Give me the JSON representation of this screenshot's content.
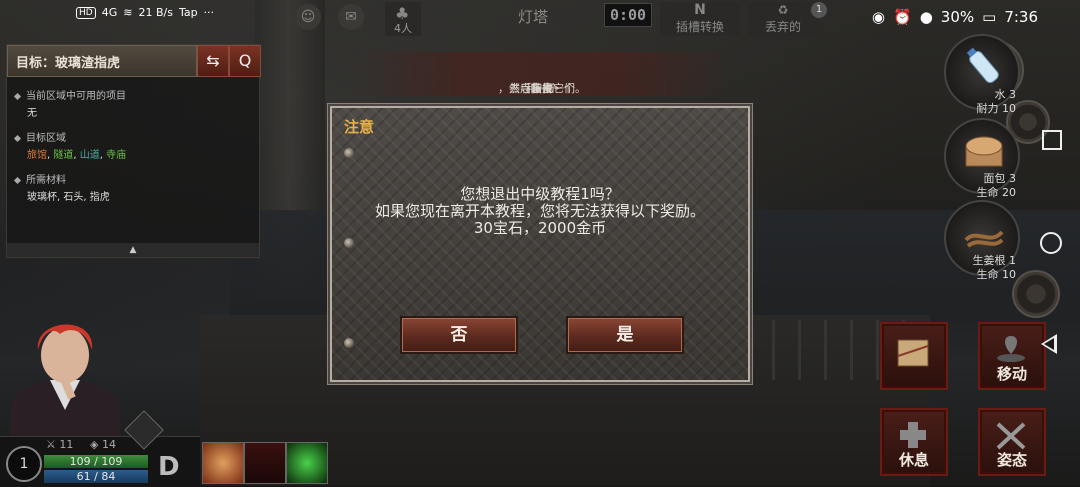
{
  "status_bar": {
    "left_items": [
      "HD",
      "4G",
      "21 B/s",
      "Tap"
    ],
    "battery": "30%",
    "time": "7:36"
  },
  "hud": {
    "group_count": "4人",
    "location": "灯塔",
    "timer": "0:00",
    "slot_switch": {
      "top": "N",
      "label": "插槽转换"
    },
    "discard": {
      "label": "丢弃的"
    },
    "notification_count": "1"
  },
  "objective": {
    "title": "目标：玻璃渣指虎",
    "sections": [
      {
        "heading": "当前区域中可用的项目",
        "value": "无"
      },
      {
        "heading": "目标区域",
        "value": "旅馆, 隧道, 山道, 寺庙"
      },
      {
        "heading": "所需材料",
        "value": "玻璃杯, 石头, 指虎"
      }
    ],
    "collapse_arrow": "▲"
  },
  "objective_banner": {
    "prefix": "去寺庙找一个",
    "item1": "布甲",
    "middle": "和一个",
    "item2": "指虎",
    "suffix": "，然后装备它们。"
  },
  "dialog": {
    "title": "注意",
    "message_lines": [
      "您想退出中级教程1吗？",
      "如果您现在离开本教程，您将无法获得以下奖励。",
      "30宝石，2000金币"
    ],
    "no_label": "否",
    "yes_label": "是"
  },
  "inventory": [
    {
      "name": "水 3",
      "stat": "耐力 10"
    },
    {
      "name": "面包 3",
      "stat": "生命 20"
    },
    {
      "name": "生姜根 1",
      "stat": "生命 10"
    }
  ],
  "actions": {
    "move": "移动",
    "rest": "休息",
    "stance": "姿态"
  },
  "player": {
    "level": "1",
    "attack": "11",
    "defense": "14",
    "hp": "109 / 109",
    "sp": "61 / 84",
    "grade": "D"
  },
  "colors": {
    "dialog_title": "#e6b14a",
    "highlight_red": "#e0443a",
    "highlight_pink": "#e86a8a",
    "area_inn": "#e07b39",
    "area_tunnel": "#6cc04a",
    "area_mountain": "#3db7a8",
    "area_temple": "#6cc04a"
  }
}
